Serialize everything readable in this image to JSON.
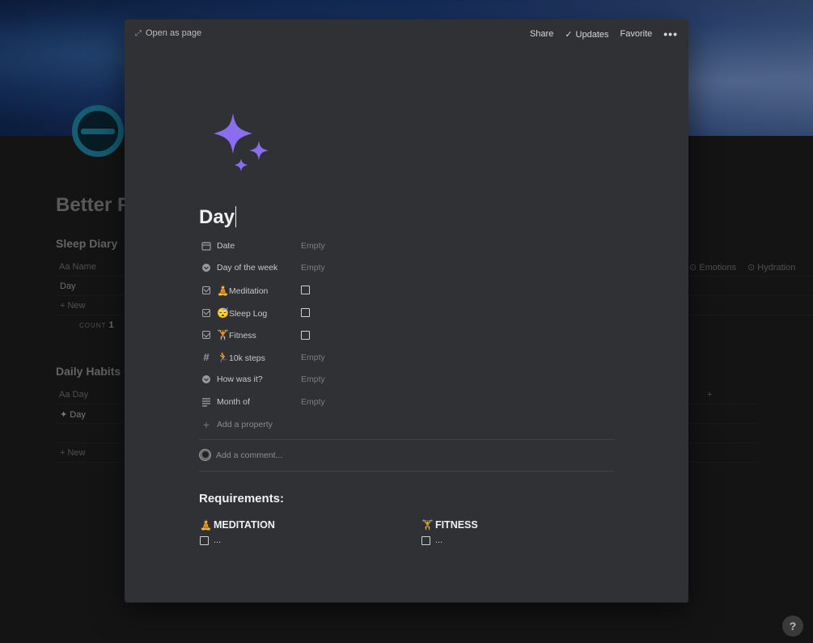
{
  "background_page": {
    "title": "Better F",
    "sleep_diary": {
      "heading": "Sleep Diary",
      "columns": [
        "Name",
        "Emotions",
        "Hydration"
      ],
      "rows": [
        "Day"
      ],
      "new_label": "New",
      "count_label": "COUNT",
      "count_value": "1"
    },
    "daily_habits": {
      "heading": "Daily Habits",
      "columns": [
        "Day"
      ],
      "rows": [
        "Day"
      ],
      "new_label": "New",
      "add_column": "+"
    }
  },
  "topbar": {
    "open_as_page": "Open as page",
    "share": "Share",
    "updates": "Updates",
    "favorite": "Favorite",
    "more": "•••"
  },
  "page": {
    "icon": "sparkles-icon",
    "title": "Day",
    "properties": [
      {
        "icon": "calendar-icon",
        "name": "Date",
        "value": "Empty",
        "type": "text"
      },
      {
        "icon": "select-icon",
        "name": "Day of the week",
        "value": "Empty",
        "type": "text"
      },
      {
        "icon": "checkbox-icon",
        "emoji": "🧘",
        "name": "Meditation",
        "type": "checkbox"
      },
      {
        "icon": "checkbox-icon",
        "emoji": "😴",
        "name": "Sleep Log",
        "type": "checkbox"
      },
      {
        "icon": "checkbox-icon",
        "emoji": "🏋",
        "name": "Fitness",
        "type": "checkbox"
      },
      {
        "icon": "number-icon",
        "emoji": "🏃",
        "name": "10k steps",
        "value": "Empty",
        "type": "text"
      },
      {
        "icon": "select-icon",
        "name": "How was it?",
        "value": "Empty",
        "type": "text"
      },
      {
        "icon": "text-icon",
        "name": "Month of",
        "value": "Empty",
        "type": "text"
      }
    ],
    "add_property": "Add a property",
    "comment_placeholder": "Add a comment...",
    "requirements": {
      "heading": "Requirements:",
      "columns": [
        {
          "emoji": "🧘",
          "title": "MEDITATION",
          "todo": "..."
        },
        {
          "emoji": "🏋",
          "title": "FITNESS",
          "todo": "..."
        }
      ]
    }
  },
  "help": "?",
  "colors": {
    "modal_bg": "#2f3134",
    "sparkle": "#8b6ef0",
    "page_bg": "#202020"
  }
}
